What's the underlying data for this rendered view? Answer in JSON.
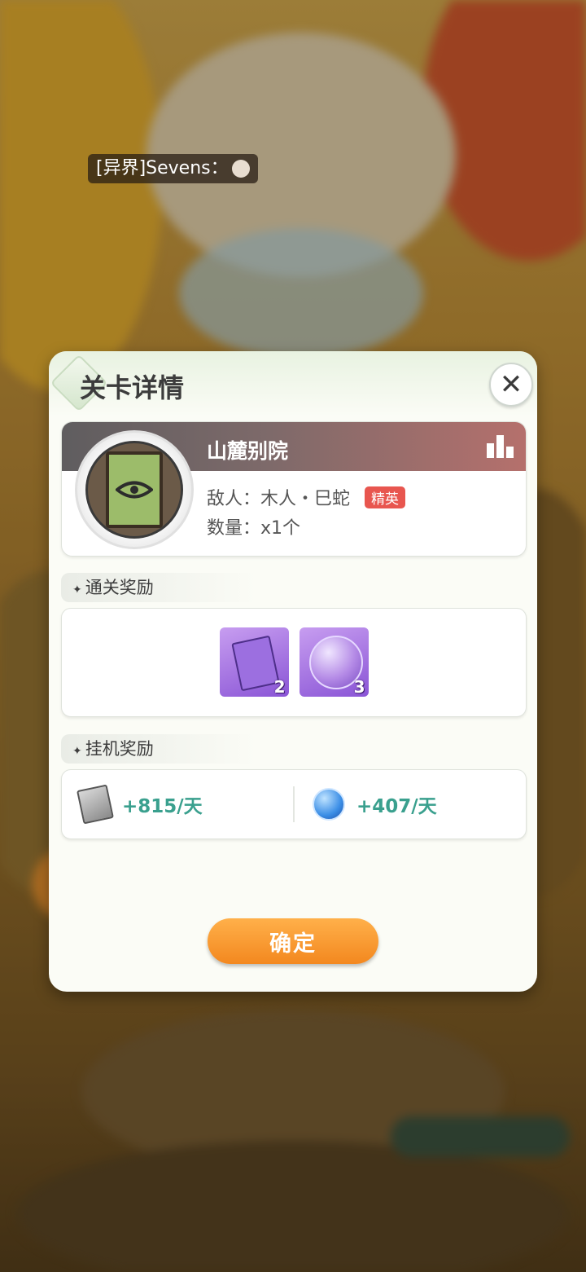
{
  "chat": {
    "text": "[异界]Sevens："
  },
  "dialog": {
    "title": "关卡详情",
    "stage": {
      "name": "山麓别院",
      "enemy_label": "敌人：木人・巳蛇",
      "elite_badge": "精英",
      "count_label": "数量：x1个"
    },
    "clear_rewards": {
      "heading": "通关奖励",
      "items": [
        {
          "icon": "purple-book-icon",
          "qty": "2"
        },
        {
          "icon": "spirit-orb-icon",
          "qty": "3"
        }
      ]
    },
    "idle_rewards": {
      "heading": "挂机奖励",
      "items": [
        {
          "icon": "silver-book-icon",
          "value": "+815/天"
        },
        {
          "icon": "blue-orb-icon",
          "value": "+407/天"
        }
      ]
    },
    "confirm_label": "确定"
  },
  "colors": {
    "accent_orange": "#f3881f",
    "elite_red": "#e8564f",
    "reward_teal": "#3aa08e"
  }
}
